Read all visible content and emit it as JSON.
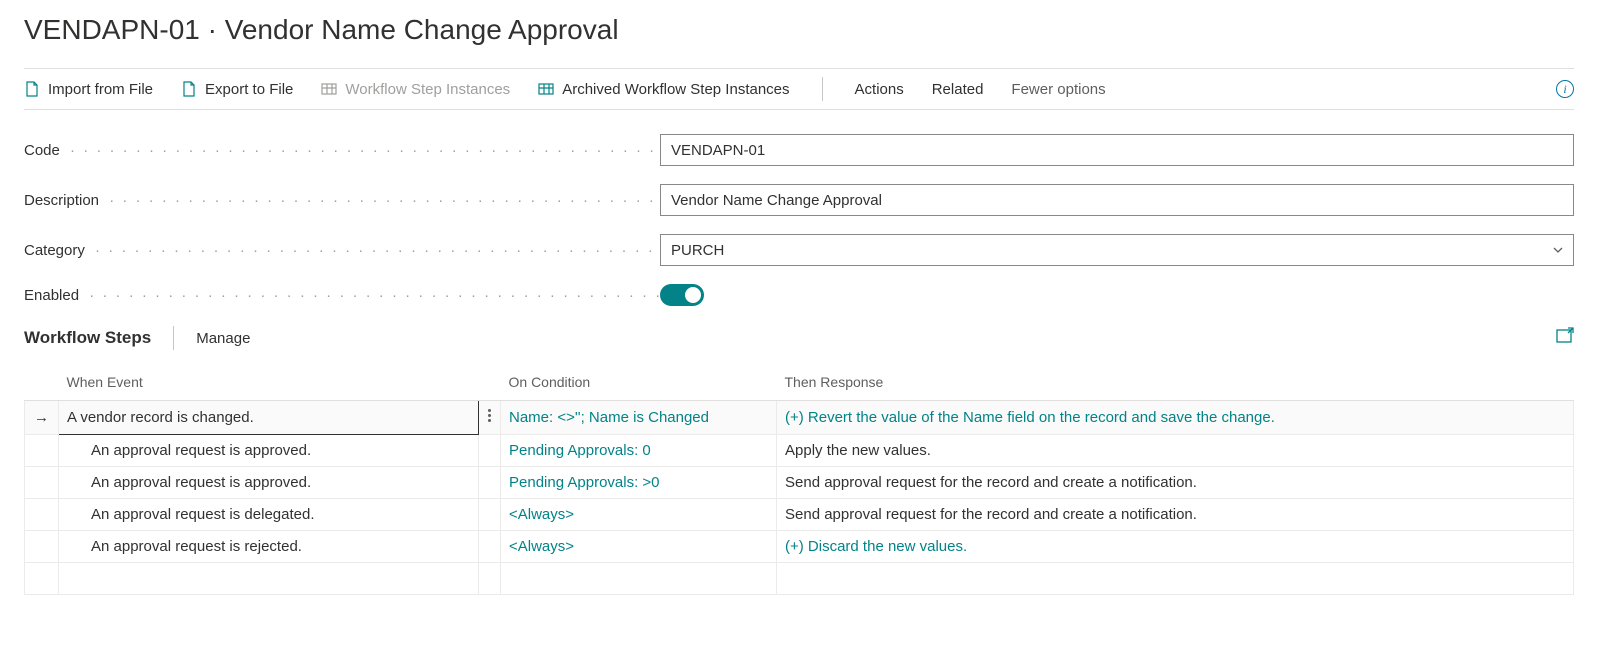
{
  "header": {
    "title": "VENDAPN-01 · Vendor Name Change Approval"
  },
  "toolbar": {
    "import": "Import from File",
    "export": "Export to File",
    "wsi": "Workflow Step Instances",
    "awsi": "Archived Workflow Step Instances",
    "actions": "Actions",
    "related": "Related",
    "fewer": "Fewer options"
  },
  "form": {
    "code_label": "Code",
    "code_value": "VENDAPN-01",
    "desc_label": "Description",
    "desc_value": "Vendor Name Change Approval",
    "cat_label": "Category",
    "cat_value": "PURCH",
    "enabled_label": "Enabled",
    "enabled": true
  },
  "section": {
    "title": "Workflow Steps",
    "manage": "Manage"
  },
  "grid": {
    "headers": {
      "event": "When Event",
      "condition": "On Condition",
      "response": "Then Response"
    },
    "rows": [
      {
        "indent": 0,
        "selected": true,
        "event": "A vendor record is changed.",
        "condition": "Name: <>''; Name is Changed",
        "response": "(+) Revert the value of the Name field on the record and save the change.",
        "response_link": true
      },
      {
        "indent": 1,
        "event": "An approval request is approved.",
        "condition": "Pending Approvals: 0",
        "response": "Apply the new values."
      },
      {
        "indent": 1,
        "event": "An approval request is approved.",
        "condition": "Pending Approvals: >0",
        "response": "Send approval request for the record and create a notification."
      },
      {
        "indent": 1,
        "event": "An approval request is delegated.",
        "condition": "<Always>",
        "response": "Send approval request for the record and create a notification."
      },
      {
        "indent": 1,
        "event": "An approval request is rejected.",
        "condition": "<Always>",
        "response": "(+) Discard the new values.",
        "response_link": true
      }
    ]
  }
}
